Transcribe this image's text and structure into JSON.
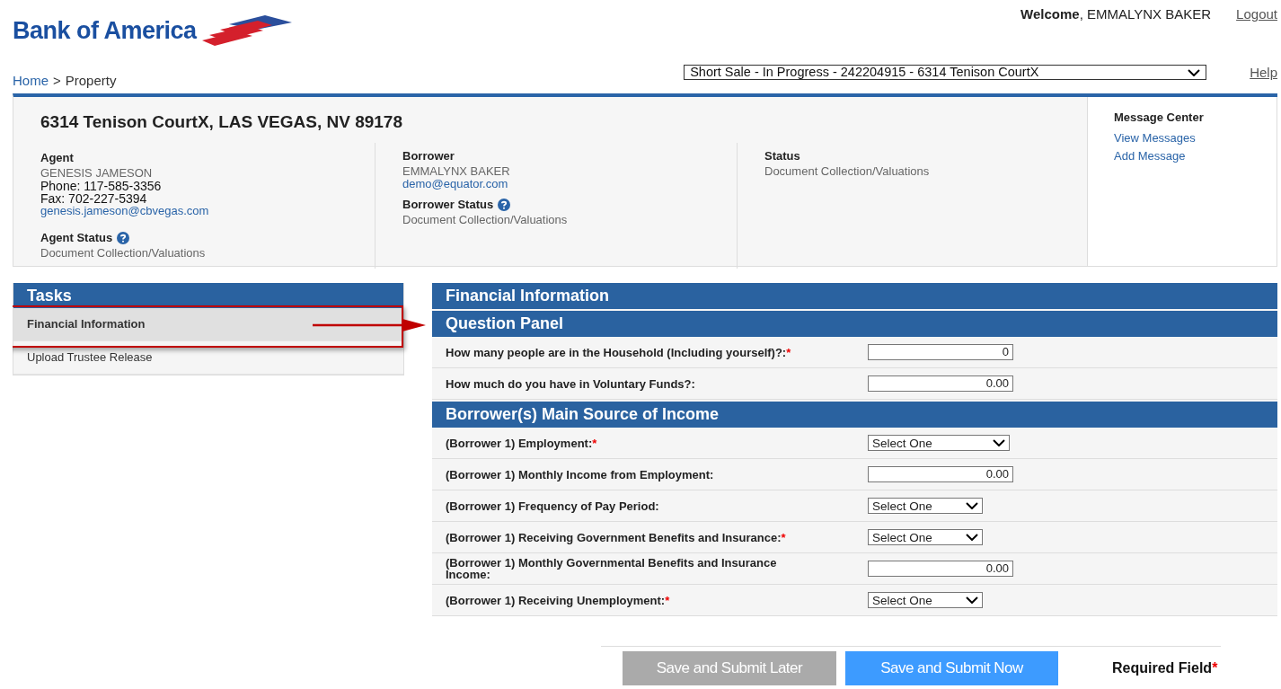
{
  "header": {
    "logo": "Bank of America",
    "welcome": "**Welcome**, EMMALYNX BAKER",
    "logout": "Logout",
    "help": "Help"
  },
  "breadcrumb": [
    {
      "label": "Home",
      "kind": "link"
    },
    {
      "label": ">",
      "kind": "text"
    },
    {
      "label": "Property",
      "kind": "text"
    }
  ],
  "property_select": {
    "value": "Short Sale - In Progress - 242204915 - 6314 Tenison CourtX"
  },
  "property": {
    "address": "6314 Tenison CourtX, LAS VEGAS, NV 89178",
    "agent": {
      "heading": "Agent",
      "name": "GENESIS JAMESON",
      "phone": "Phone: 117-585-3356",
      "fax": "Fax: 702-227-5394",
      "email": "genesis.jameson@cbvegas.com",
      "status_heading": "Agent Status",
      "status": "Document Collection/Valuations"
    },
    "borrower": {
      "heading": "Borrower",
      "name": "EMMALYNX BAKER",
      "email": "demo@equator.com",
      "status_heading": "Borrower Status",
      "status": "Document Collection/Valuations"
    },
    "status": {
      "heading": "Status",
      "value": "Document Collection/Valuations"
    }
  },
  "message_center": {
    "title": "Message Center",
    "links": [
      "View Messages",
      "Add Message"
    ]
  },
  "tasks": {
    "title": "Tasks",
    "items": [
      {
        "label": "Financial Information",
        "selected": true
      },
      {
        "label": "Upload Trustee Release",
        "selected": false
      }
    ]
  },
  "form": {
    "title": "Financial Information",
    "sections": [
      {
        "title": "Question Panel",
        "rows": [
          {
            "label": "How many people are in the Household (Including yourself)?:",
            "required": true,
            "kind": "input",
            "value": "0"
          },
          {
            "label": "How much do you have in Voluntary Funds?:",
            "required": false,
            "kind": "input",
            "value": "0.00"
          }
        ]
      },
      {
        "title": "Borrower(s) Main Source of Income",
        "rows": [
          {
            "label": "(Borrower 1) Employment:",
            "required": true,
            "kind": "select",
            "value": "Select One",
            "wide": true
          },
          {
            "label": "(Borrower 1) Monthly Income from Employment:",
            "required": false,
            "kind": "input",
            "value": "0.00"
          },
          {
            "label": "(Borrower 1) Frequency of Pay Period:",
            "required": false,
            "kind": "select",
            "value": "Select One",
            "wide": false
          },
          {
            "label": "(Borrower 1) Receiving Government Benefits and Insurance:",
            "required": true,
            "kind": "select",
            "value": "Select One",
            "wide": false
          },
          {
            "label": "(Borrower 1) Monthly Governmental Benefits and Insurance Income:",
            "required": false,
            "kind": "input",
            "value": "0.00"
          },
          {
            "label": "(Borrower 1) Receiving Unemployment:",
            "required": true,
            "kind": "select",
            "value": "Select One",
            "wide": false
          }
        ]
      }
    ]
  },
  "buttons": [
    {
      "label": "Save and Submit Later",
      "disabled": true
    },
    {
      "label": "Save and Submit Now",
      "disabled": false
    }
  ],
  "required_note": {
    "label": "Required Field",
    "mark": "*"
  }
}
